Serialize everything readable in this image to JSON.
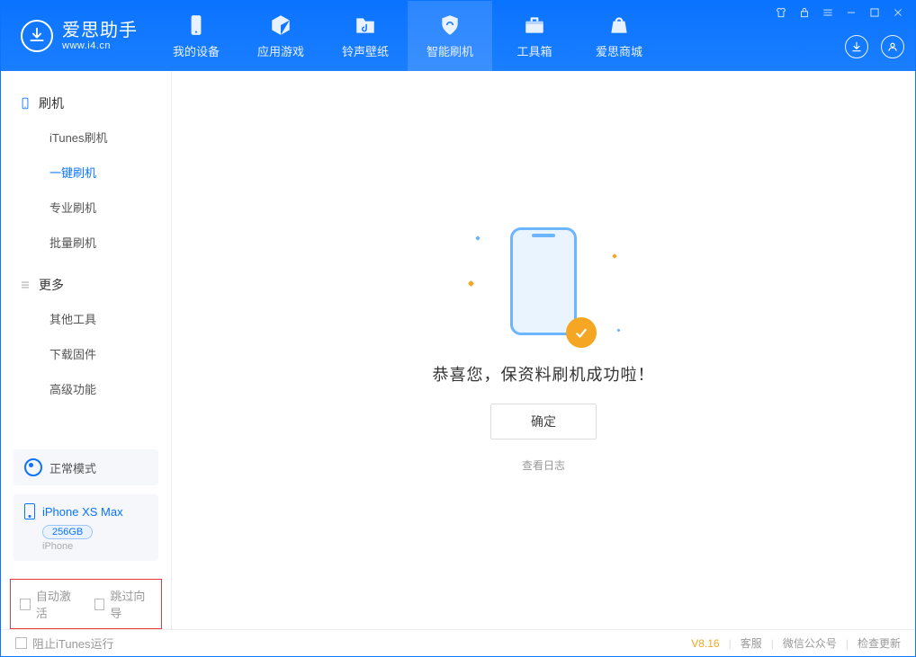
{
  "app": {
    "name": "爱思助手",
    "url": "www.i4.cn"
  },
  "nav": [
    {
      "label": "我的设备"
    },
    {
      "label": "应用游戏"
    },
    {
      "label": "铃声壁纸"
    },
    {
      "label": "智能刷机"
    },
    {
      "label": "工具箱"
    },
    {
      "label": "爱思商城"
    }
  ],
  "sidebar": {
    "group1_title": "刷机",
    "group1_items": [
      "iTunes刷机",
      "一键刷机",
      "专业刷机",
      "批量刷机"
    ],
    "group2_title": "更多",
    "group2_items": [
      "其他工具",
      "下载固件",
      "高级功能"
    ]
  },
  "device": {
    "mode": "正常模式",
    "name": "iPhone XS Max",
    "capacity": "256GB",
    "type": "iPhone"
  },
  "options": {
    "auto_activate": "自动激活",
    "skip_guide": "跳过向导"
  },
  "main": {
    "success_text": "恭喜您，保资料刷机成功啦！",
    "ok_button": "确定",
    "view_log": "查看日志"
  },
  "footer": {
    "block_itunes": "阻止iTunes运行",
    "version": "V8.16",
    "support": "客服",
    "wechat": "微信公众号",
    "check_update": "检查更新"
  }
}
